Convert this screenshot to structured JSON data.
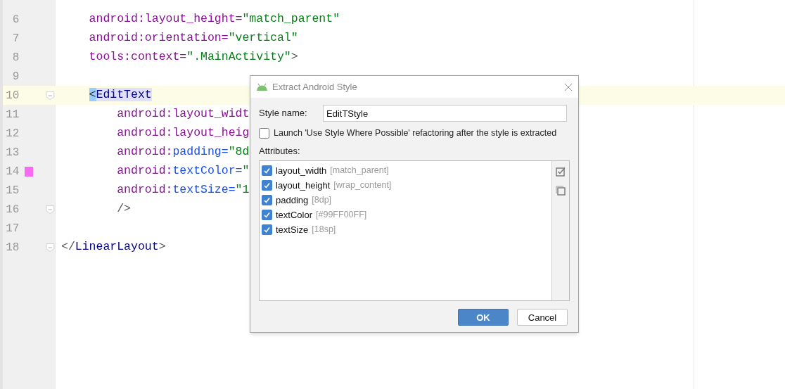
{
  "editor": {
    "lines": [
      {
        "number": "6",
        "folded": false,
        "current": false,
        "segments": [
          {
            "text": "    android:layout_height=",
            "kind": "attr"
          },
          {
            "text": "\"match_parent\"",
            "kind": "value"
          }
        ]
      },
      {
        "number": "7",
        "folded": false,
        "current": false,
        "segments": [
          {
            "text": "    android:orientation=",
            "kind": "attr"
          },
          {
            "text": "\"vertical\"",
            "kind": "value"
          }
        ]
      },
      {
        "number": "8",
        "folded": false,
        "current": false,
        "segments": [
          {
            "text": "    tools:context=",
            "kind": "attr"
          },
          {
            "text": "\".MainActivity\"",
            "kind": "value"
          },
          {
            "text": ">",
            "kind": "punct"
          }
        ]
      },
      {
        "number": "9",
        "folded": false,
        "current": false
      },
      {
        "number": "10",
        "folded": true,
        "current": true,
        "segments": [
          {
            "text": "    <",
            "kind": "bracket"
          },
          {
            "text": "EditText",
            "kind": "tagmatch"
          }
        ]
      },
      {
        "number": "11",
        "folded": false,
        "current": false,
        "segments": [
          {
            "text": "        android:layout_widt",
            "kind": "attr"
          }
        ]
      },
      {
        "number": "12",
        "folded": false,
        "current": false,
        "segments": [
          {
            "text": "        android:layout_heig",
            "kind": "attr"
          }
        ]
      },
      {
        "number": "13",
        "folded": false,
        "current": false,
        "segments": [
          {
            "text": "        android:",
            "kind": "attr"
          },
          {
            "text": "padding=",
            "kind": "attr2"
          },
          {
            "text": "\"8d",
            "kind": "value"
          }
        ]
      },
      {
        "number": "14",
        "folded": false,
        "current": false,
        "color": "#f76bf0",
        "segments": [
          {
            "text": "        android:",
            "kind": "attr"
          },
          {
            "text": "textColor=",
            "kind": "attr2"
          },
          {
            "text": "\"",
            "kind": "value"
          }
        ]
      },
      {
        "number": "15",
        "folded": false,
        "current": false,
        "segments": [
          {
            "text": "        android:",
            "kind": "attr"
          },
          {
            "text": "textSize=",
            "kind": "attr2"
          },
          {
            "text": "\"1",
            "kind": "value"
          }
        ]
      },
      {
        "number": "16",
        "folded": true,
        "current": false,
        "segments": [
          {
            "text": "        />",
            "kind": "punct"
          }
        ]
      },
      {
        "number": "17",
        "folded": false,
        "current": false
      },
      {
        "number": "18",
        "folded": true,
        "current": false,
        "segments": [
          {
            "text": "</",
            "kind": "punct"
          },
          {
            "text": "LinearLayout",
            "kind": "tag"
          },
          {
            "text": ">",
            "kind": "punct"
          }
        ]
      }
    ]
  },
  "dialog": {
    "title": "Extract Android Style",
    "style_name_label": "Style name:",
    "style_name_value": "EditTStyle",
    "launch": {
      "label": "Launch 'Use Style Where Possible' refactoring after the style is extracted",
      "checked": false
    },
    "attributes_label": "Attributes:",
    "attributes": [
      {
        "name": "layout_width",
        "value": "[match_parent]",
        "checked": true
      },
      {
        "name": "layout_height",
        "value": "[wrap_content]",
        "checked": true
      },
      {
        "name": "padding",
        "value": "[8dp]",
        "checked": true
      },
      {
        "name": "textColor",
        "value": "[#99FF00FF]",
        "checked": true
      },
      {
        "name": "textSize",
        "value": "[18sp]",
        "checked": true
      }
    ],
    "buttons": [
      {
        "label": "OK",
        "kind": "primary"
      },
      {
        "label": "Cancel",
        "kind": "secondary"
      }
    ]
  }
}
